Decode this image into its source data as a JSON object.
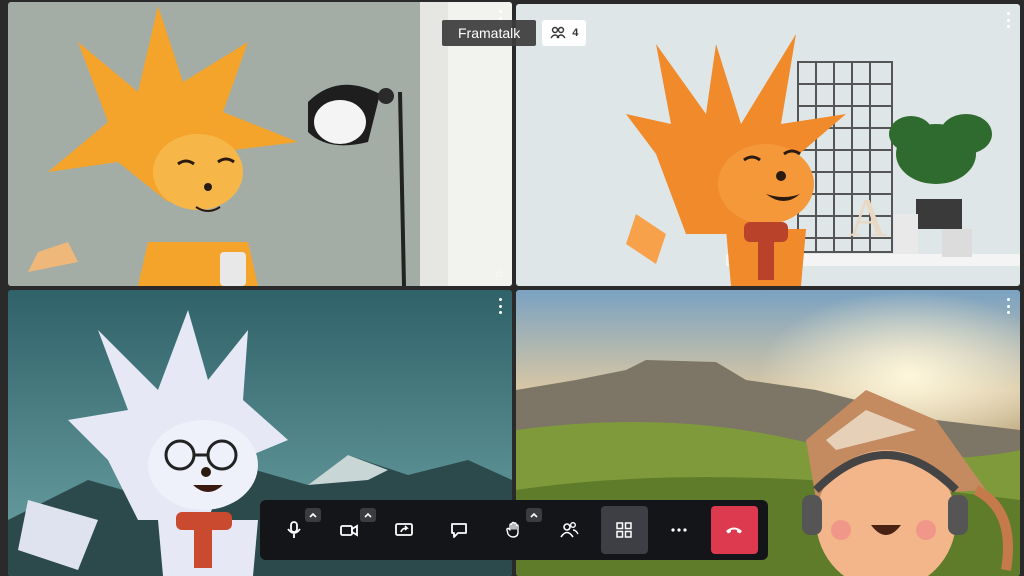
{
  "header": {
    "room_name": "Framatalk",
    "participant_count": "4",
    "participants_icon": "participants-icon"
  },
  "tiles": [
    {
      "id": "participant-1",
      "background": "#a3ada6",
      "avatar": "orange-fox"
    },
    {
      "id": "participant-2",
      "background": "#dfe6e8",
      "avatar": "orange-fox-scarf"
    },
    {
      "id": "participant-3",
      "background": "#3e6f78",
      "avatar": "white-fox-glasses"
    },
    {
      "id": "participant-4",
      "background": "#8fa24a",
      "avatar": "round-creature-headphones"
    }
  ],
  "toolbar": {
    "buttons": [
      {
        "name": "microphone",
        "icon": "microphone-icon",
        "has_options": true
      },
      {
        "name": "camera",
        "icon": "camera-icon",
        "has_options": true
      },
      {
        "name": "screen-share",
        "icon": "screen-share-icon",
        "has_options": false
      },
      {
        "name": "chat",
        "icon": "chat-icon",
        "has_options": false
      },
      {
        "name": "raise-hand",
        "icon": "hand-icon",
        "has_options": true
      },
      {
        "name": "participants",
        "icon": "participants-icon",
        "has_options": false
      },
      {
        "name": "tile-view",
        "icon": "grid-icon",
        "has_options": false,
        "active": true
      },
      {
        "name": "more-actions",
        "icon": "more-icon",
        "has_options": false
      },
      {
        "name": "hang-up",
        "icon": "phone-hangup-icon",
        "has_options": false
      }
    ]
  },
  "colors": {
    "toolbar_bg": "#131519",
    "hangup": "#dd3a50",
    "active_button": "#3d3f44"
  }
}
